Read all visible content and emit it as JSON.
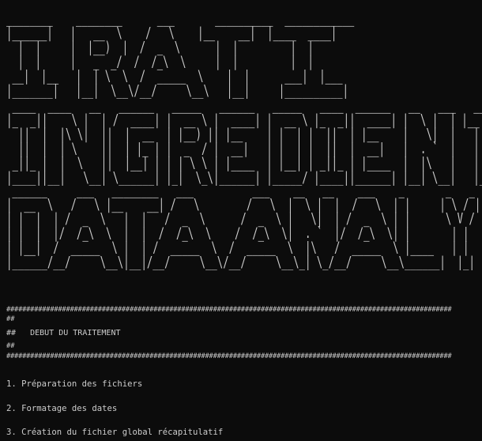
{
  "terminal": {
    "banner": {
      "line_1": "IRATI",
      "line_2": "INGREDIENTS",
      "line_3": "DATA ANALYSE",
      "ascii_1": "________    ________      ___       __________  ____________\n|______|   |   __  \\    /   \\    |__    __|  |____  ____|\n  |  |     |  |__)  |  /  _  \\      |  |         |  |\n  |  |     |   _  _/  /  /_\\  \\     |  |         |  |\n __|  |__   |  | \\  \\  /  _____  \\    |  |      ___|  |___\n|_______|   |__|  \\__\\/__/     \\__\\   |__|     |__________|",
      "ascii_2": " ____  ____   __   ______   _____   ______   _____   ____  ______   __   ___   ______   _____\n|_  _||    \\ |  | /  ____| |  __ \\ |  ____| |  __ \\ |_  _||  ____| |  \\ |  | |__  __| /  ___|\n  ||  |  |\\ \\|  ||  |  __  | |__) || |__    | |  | |  ||  | |__    |   \\|  |   |  |   \\  `--.\n  ||  |  | \\    ||  | |_ | |  _  / |  __|   | |  | |  ||  |  __|   |  . `  |   |  |    `--. \\\n _||_ |  |  \\   ||  |__| | | | \\ \\ | |____  | |__| | _||_ | |____  |  |\\   |   |  |   /\\__/ /\n|____||__|   \\__| \\______| |_|  \\_\\|______| |_____/ |____||______| |__| \\__|   |__|   \\____/",
      "ascii_3": " ______     ___   ________   ___          ___    __   __    ___    _       _   _   _____  ______\n|  __  \\   /   \\ |__    __| /   \\        /   \\  |  \\ |  |  /   \\  | |     | \\ / | /  ___||  ____|\n| |  |  | /  _  \\   |  |   /  _  \\      /  _  \\ |   \\|  | /  _  \\ | |      \\ V /  \\  `--.| |__\n| |  |  |/  /_\\  \\  |  |  /  /_\\  \\    /  /_\\  \\|  . `  |/  /_\\  \\| |       | |    `--. \\  __|\n| |__|  /  _____  \\ |  | /  _____  \\  /  _____  \\  |\\   /  _____  \\ |____   | |   /\\__/ / |____\n|______/__/     \\__\\|__|/__/     \\__\\/__/     \\__\\_| \\_/__/     \\__\\______|  |_|   \\____/|______|"
    },
    "separator_top": "################################################################################################################",
    "prefix_line_a": "##",
    "title_line": "##   DEBUT DU TRAITEMENT",
    "prefix_line_b": "##",
    "separator_bottom": "################################################################################################################",
    "steps": [
      "1. Préparation des fichiers",
      "2. Formatage des dates",
      "3. Création du fichier global récapitulatif"
    ],
    "colors": {
      "background": "#0c0c0c",
      "foreground": "#cccccc"
    }
  }
}
